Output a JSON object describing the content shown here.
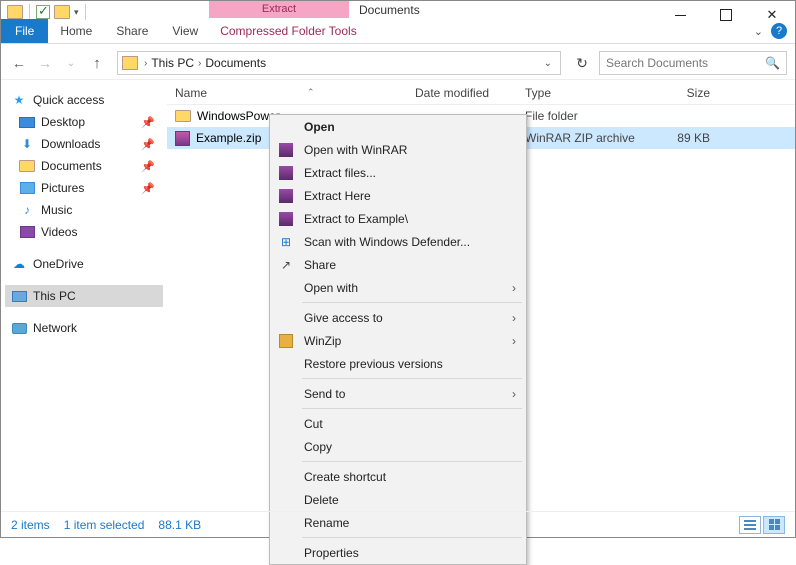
{
  "title_bar": {
    "context_tab": "Extract",
    "window_title": "Documents"
  },
  "ribbon": {
    "file": "File",
    "home": "Home",
    "share": "Share",
    "view": "View",
    "ctx_tool": "Compressed Folder Tools"
  },
  "addr": {
    "crumb1": "This PC",
    "crumb2": "Documents"
  },
  "search": {
    "placeholder": "Search Documents"
  },
  "sidebar": {
    "quick_access": "Quick access",
    "desktop": "Desktop",
    "downloads": "Downloads",
    "documents": "Documents",
    "pictures": "Pictures",
    "music": "Music",
    "videos": "Videos",
    "onedrive": "OneDrive",
    "this_pc": "This PC",
    "network": "Network"
  },
  "columns": {
    "name": "Name",
    "date": "Date modified",
    "type": "Type",
    "size": "Size"
  },
  "rows": [
    {
      "name": "WindowsPower",
      "type": "File folder",
      "size": ""
    },
    {
      "name": "Example.zip",
      "type": "WinRAR ZIP archive",
      "size": "89 KB"
    }
  ],
  "ctx": {
    "open": "Open",
    "open_winrar": "Open with WinRAR",
    "extract_files": "Extract files...",
    "extract_here": "Extract Here",
    "extract_to": "Extract to Example\\",
    "scan_defender": "Scan with Windows Defender...",
    "share": "Share",
    "open_with": "Open with",
    "give_access": "Give access to",
    "winzip": "WinZip",
    "restore": "Restore previous versions",
    "send_to": "Send to",
    "cut": "Cut",
    "copy": "Copy",
    "shortcut": "Create shortcut",
    "delete": "Delete",
    "rename": "Rename",
    "properties": "Properties"
  },
  "status": {
    "items": "2 items",
    "selected": "1 item selected",
    "size": "88.1 KB"
  }
}
